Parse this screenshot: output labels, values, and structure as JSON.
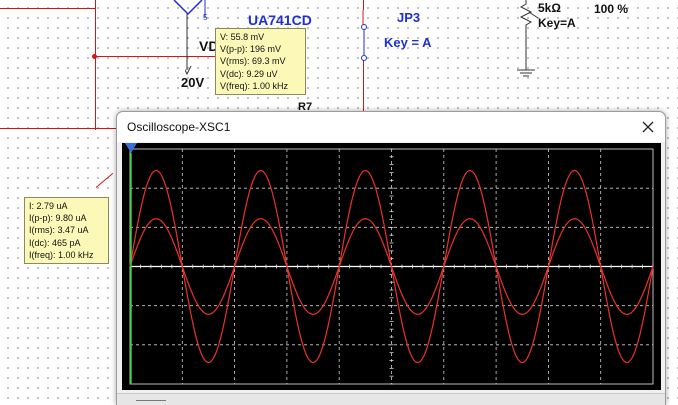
{
  "schematic": {
    "opamp_label": "UA741CD",
    "vd_label": "VD",
    "supply_label": "20V",
    "jumper_label": "JP3",
    "jumper_key": "Key = A",
    "pot_value": "5kΩ",
    "pot_key": "Key=A",
    "pot_percent": "100 %",
    "part_fragment": "R7",
    "opamp_pin": "5"
  },
  "voltage_probe": {
    "lines": [
      "V: 55.8 mV",
      "V(p-p): 196 mV",
      "V(rms): 69.3 mV",
      "V(dc): 9.29 uV",
      "V(freq): 1.00 kHz"
    ]
  },
  "current_probe": {
    "lines": [
      "I: 2.79 uA",
      "I(p-p): 9.80 uA",
      "I(rms): 3.47 uA",
      "I(dc): 465 pA",
      "I(freq): 1.00 kHz"
    ]
  },
  "scope": {
    "title": "Oscilloscope-XSC1",
    "close_icon": "close-icon",
    "cursor_marker": "T1",
    "grid_divisions_x": 10,
    "grid_divisions_y": 6,
    "colors": {
      "screen": "#000000",
      "grid": "#cfcfcf",
      "trace": "#e8332b",
      "cursor": "#2ad02a",
      "baseline": "#ffffff"
    }
  },
  "chart_data": {
    "type": "line",
    "title": "",
    "xlabel": "",
    "ylabel": "",
    "grid": true,
    "xlim": [
      0,
      10
    ],
    "ylim": [
      -3,
      3
    ],
    "cycles": 5,
    "series": [
      {
        "amplitude": 2.45,
        "color": "#e8332b"
      },
      {
        "amplitude": 1.22,
        "color": "#e8332b"
      }
    ]
  }
}
